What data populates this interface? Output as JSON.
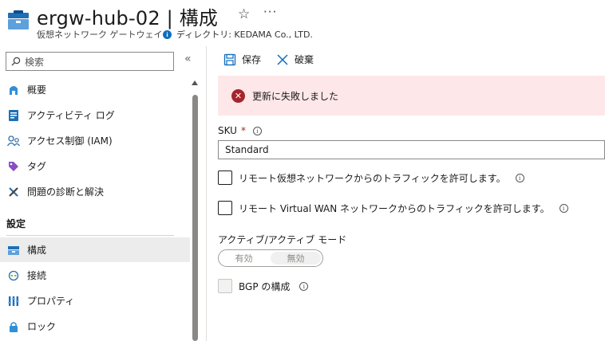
{
  "header": {
    "title": "ergw-hub-02 | 構成",
    "subtitle": "仮想ネットワーク ゲートウェイ",
    "directory": "ディレクトリ: KEDAMA Co., LTD.",
    "star_icon": "☆",
    "more_icon": "···"
  },
  "sidebar": {
    "search_placeholder": "検索",
    "collapse_icon": "«",
    "items": [
      {
        "label": "概要",
        "icon": "overview-icon"
      },
      {
        "label": "アクティビティ ログ",
        "icon": "activity-log-icon"
      },
      {
        "label": "アクセス制御 (IAM)",
        "icon": "iam-icon"
      },
      {
        "label": "タグ",
        "icon": "tag-icon"
      },
      {
        "label": "問題の診断と解決",
        "icon": "diagnose-icon"
      }
    ],
    "section_title": "設定",
    "settings_items": [
      {
        "label": "構成",
        "icon": "configuration-icon",
        "active": true
      },
      {
        "label": "接続",
        "icon": "connections-icon"
      },
      {
        "label": "プロパティ",
        "icon": "properties-icon"
      },
      {
        "label": "ロック",
        "icon": "lock-icon"
      }
    ]
  },
  "toolbar": {
    "save_label": "保存",
    "discard_label": "破棄"
  },
  "banner": {
    "message": "更新に失敗しました",
    "color": "#fde7e9"
  },
  "form": {
    "sku_label": "SKU",
    "required_mark": "*",
    "sku_value": "Standard",
    "allow_remote_vnet": "リモート仮想ネットワークからのトラフィックを許可します。",
    "allow_remote_vwan": "リモート Virtual WAN ネットワークからのトラフィックを許可します。",
    "active_active_label": "アクティブ/アクティブ モード",
    "toggle_on": "有効",
    "toggle_off": "無効",
    "bgp_label": "BGP の構成",
    "info_glyph": "i"
  },
  "colors": {
    "accent": "#0f6cbd",
    "error": "#a4262c"
  }
}
